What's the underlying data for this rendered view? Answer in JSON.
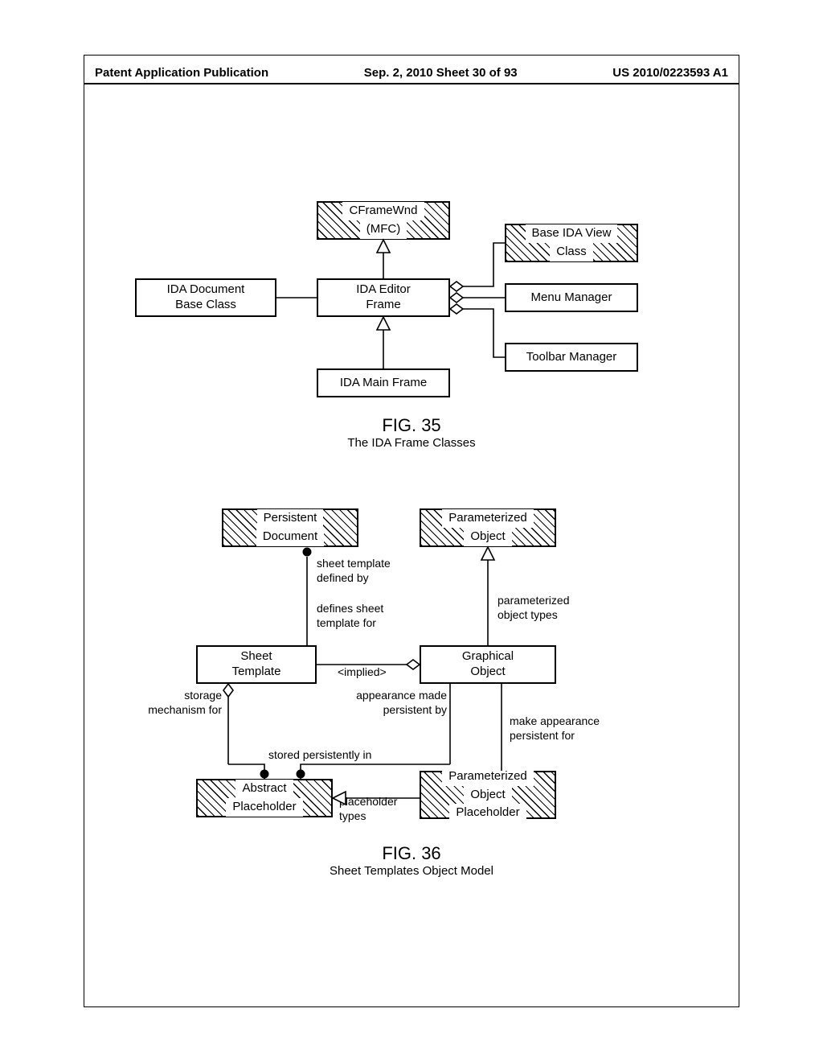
{
  "header": {
    "left": "Patent Application Publication",
    "center": "Sep. 2, 2010  Sheet 30 of 93",
    "right": "US 2010/0223593 A1"
  },
  "fig35": {
    "title": "FIG. 35",
    "subtitle": "The IDA Frame Classes",
    "cframewnd_l1": "CFrameWnd",
    "cframewnd_l2": "(MFC)",
    "base_ida_view_l1": "Base IDA View",
    "base_ida_view_l2": "Class",
    "ida_document_l1": "IDA Document",
    "ida_document_l2": "Base Class",
    "ida_editor_l1": "IDA Editor",
    "ida_editor_l2": "Frame",
    "menu_manager": "Menu Manager",
    "toolbar_manager": "Toolbar Manager",
    "ida_main_frame": "IDA Main Frame"
  },
  "fig36": {
    "title": "FIG. 36",
    "subtitle": "Sheet Templates Object Model",
    "persistent_doc_l1": "Persistent",
    "persistent_doc_l2": "Document",
    "param_obj_l1": "Parameterized",
    "param_obj_l2": "Object",
    "sheet_template_l1": "Sheet",
    "sheet_template_l2": "Template",
    "implied": "<implied>",
    "graphical_obj_l1": "Graphical",
    "graphical_obj_l2": "Object",
    "abstract_ph_l1": "Abstract",
    "abstract_ph_l2": "Placeholder",
    "param_obj_ph_l1": "Parameterized",
    "param_obj_ph_l2": "Object",
    "param_obj_ph_l3": "Placeholder",
    "lbl_sheet_tpl_defined_by": "sheet template\ndefined by",
    "lbl_defines_sheet_tpl_for": "defines sheet\ntemplate for",
    "lbl_parameterized_obj_types": "parameterized\nobject types",
    "lbl_storage_mech_for": "storage\nmechanism for",
    "lbl_appearance_made_persistent_by": "appearance made\npersistent by",
    "lbl_make_appearance_persistent_for": "make appearance\npersistent for",
    "lbl_stored_persistently_in": "stored persistently in",
    "lbl_placeholder_types": "placeholder\ntypes"
  }
}
